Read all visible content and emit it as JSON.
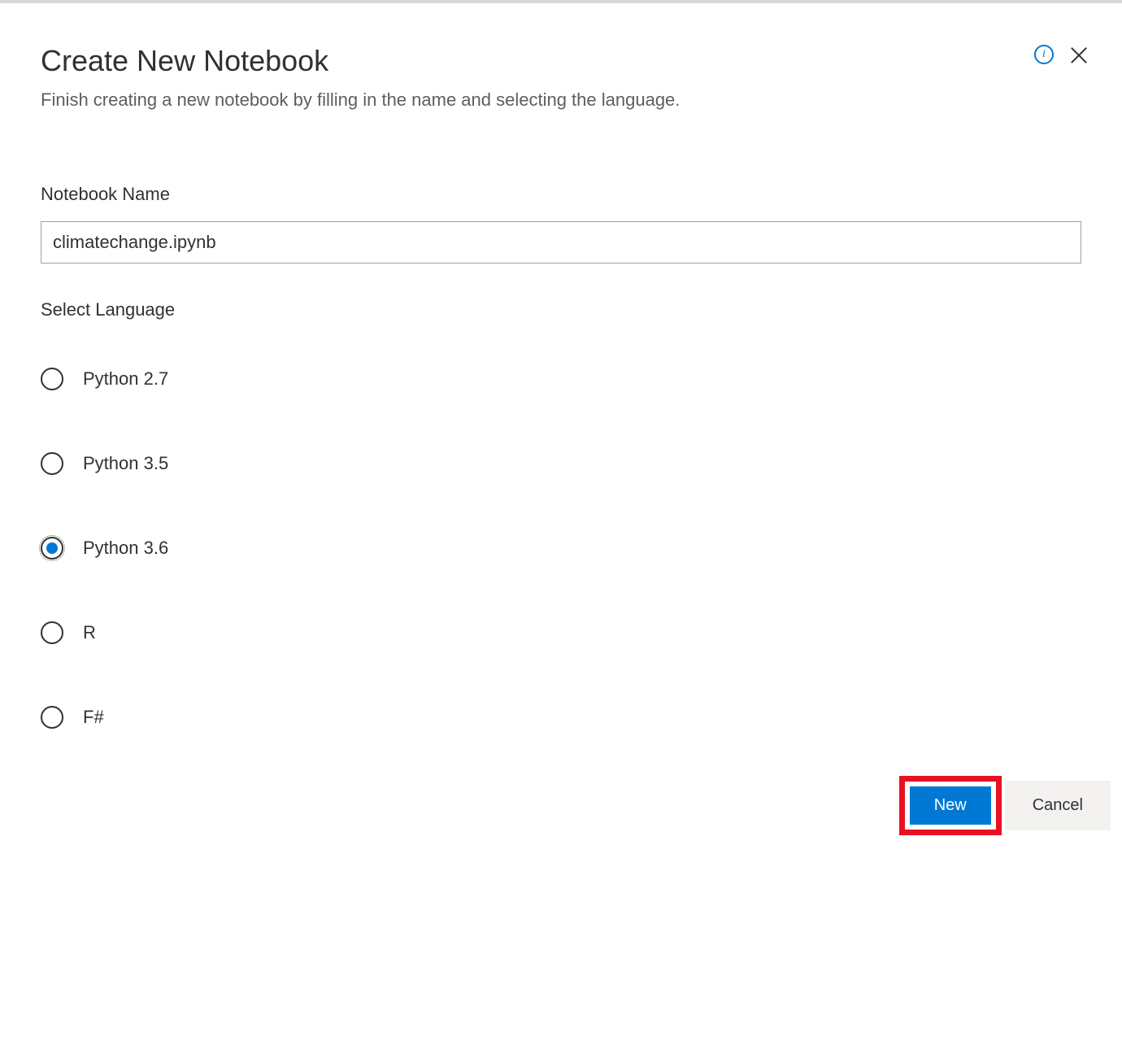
{
  "dialog": {
    "title": "Create New Notebook",
    "subtitle": "Finish creating a new notebook by filling in the name and selecting the language."
  },
  "form": {
    "name_label": "Notebook Name",
    "name_value": "climatechange.ipynb",
    "language_label": "Select Language",
    "languages": [
      {
        "label": "Python 2.7",
        "selected": false
      },
      {
        "label": "Python 3.5",
        "selected": false
      },
      {
        "label": "Python 3.6",
        "selected": true
      },
      {
        "label": "R",
        "selected": false
      },
      {
        "label": "F#",
        "selected": false
      }
    ]
  },
  "footer": {
    "primary_label": "New",
    "secondary_label": "Cancel"
  },
  "colors": {
    "accent": "#0078d4",
    "highlight": "#e81123"
  }
}
